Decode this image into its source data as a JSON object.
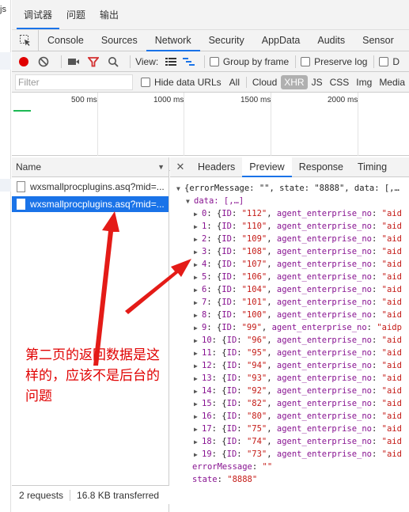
{
  "left_strip": {
    "label": "js"
  },
  "top_tabs": [
    "调试器",
    "问题",
    "输出"
  ],
  "main_tabs": [
    "Console",
    "Sources",
    "Network",
    "Security",
    "AppData",
    "Audits",
    "Sensor"
  ],
  "toolbar": {
    "view_label": "View:",
    "group_by_frame": "Group by frame",
    "preserve_log": "Preserve log",
    "disable_cache_partial": "D"
  },
  "filter": {
    "placeholder": "Filter",
    "hide_data_urls": "Hide data URLs",
    "types": [
      "All",
      "Cloud",
      "XHR",
      "JS",
      "CSS",
      "Img",
      "Media"
    ]
  },
  "timeline": {
    "ticks": [
      "500 ms",
      "1000 ms",
      "1500 ms",
      "2000 ms"
    ]
  },
  "requests": {
    "header": "Name",
    "rows": [
      "wxsmallprocplugins.asq?mid=...",
      "wxsmallprocplugins.asq?mid=..."
    ],
    "status": {
      "count": "2 requests",
      "transferred": "16.8 KB transferred"
    }
  },
  "detail_tabs": [
    "Headers",
    "Preview",
    "Response",
    "Timing"
  ],
  "preview": {
    "root": "{errorMessage: \"\", state: \"8888\", data: [,…",
    "data_line": "data: [,…]",
    "items": [
      {
        "index": "0",
        "id": "\"112\""
      },
      {
        "index": "1",
        "id": "\"110\""
      },
      {
        "index": "2",
        "id": "\"109\""
      },
      {
        "index": "3",
        "id": "\"108\""
      },
      {
        "index": "4",
        "id": "\"107\""
      },
      {
        "index": "5",
        "id": "\"106\""
      },
      {
        "index": "6",
        "id": "\"104\""
      },
      {
        "index": "7",
        "id": "\"101\""
      },
      {
        "index": "8",
        "id": "\"100\""
      },
      {
        "index": "9",
        "id": "\"99\""
      },
      {
        "index": "10",
        "id": "\"96\""
      },
      {
        "index": "11",
        "id": "\"95\""
      },
      {
        "index": "12",
        "id": "\"94\""
      },
      {
        "index": "13",
        "id": "\"93\""
      },
      {
        "index": "14",
        "id": "\"92\""
      },
      {
        "index": "15",
        "id": "\"82\""
      },
      {
        "index": "16",
        "id": "\"80\""
      },
      {
        "index": "17",
        "id": "\"75\""
      },
      {
        "index": "18",
        "id": "\"74\""
      },
      {
        "index": "19",
        "id": "\"73\""
      }
    ],
    "item_key": "ID",
    "item_field": "agent_enterprise_no",
    "item_tail": "\"aid",
    "item_tail_9": "\"aidp",
    "error_message_line": {
      "key": "errorMessage",
      "value": "\"\""
    },
    "state_line": {
      "key": "state",
      "value": "\"8888\""
    }
  },
  "annotation": {
    "text": "第二页的返回数据是这样的，应该不是后台的问题",
    "color": "#e00000"
  },
  "colors": {
    "accent": "#1a73e8",
    "record": "#e00000",
    "filter_icon": "#d32f2f"
  }
}
